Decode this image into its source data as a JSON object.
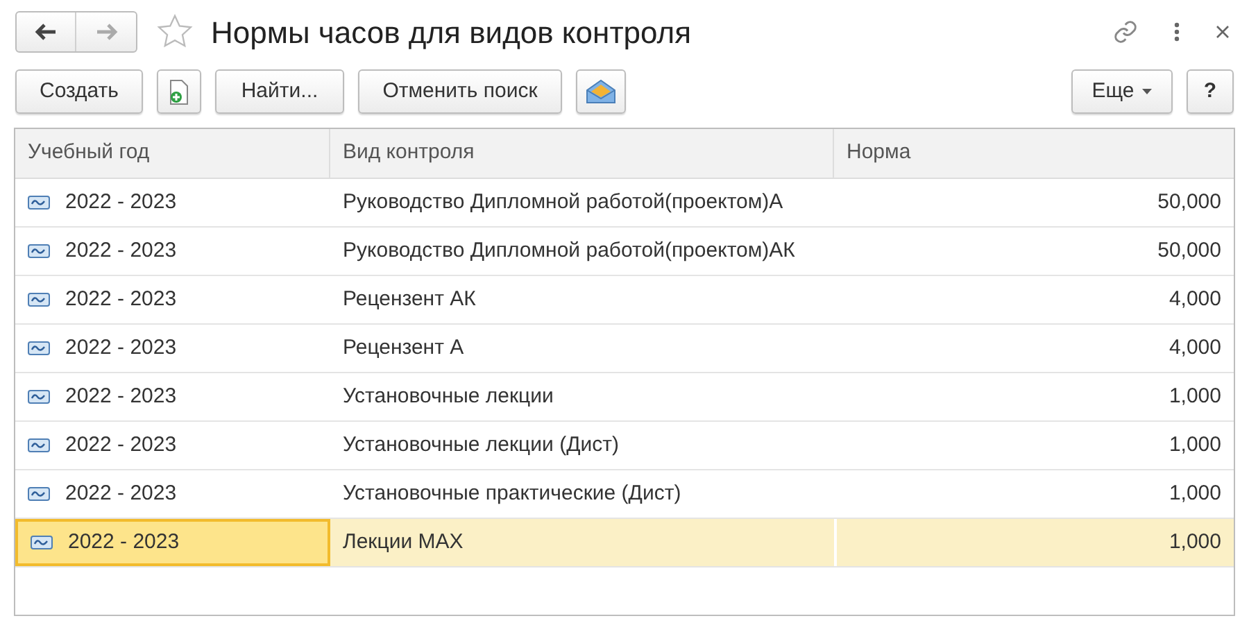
{
  "window": {
    "title": "Нормы часов для видов контроля",
    "favorite": false
  },
  "toolbar": {
    "create": "Создать",
    "find": "Найти...",
    "cancel_search": "Отменить поиск",
    "more": "Еще",
    "help": "?"
  },
  "table": {
    "columns": [
      "Учебный год",
      "Вид контроля",
      "Норма"
    ],
    "rows": [
      {
        "year": "2022 - 2023",
        "kind": "Руководство Дипломной работой(проектом)А",
        "norm": "50,000",
        "selected": false
      },
      {
        "year": "2022 - 2023",
        "kind": "Руководство Дипломной работой(проектом)АК",
        "norm": "50,000",
        "selected": false
      },
      {
        "year": "2022 - 2023",
        "kind": "Рецензент АК",
        "norm": "4,000",
        "selected": false
      },
      {
        "year": "2022 - 2023",
        "kind": "Рецензент А",
        "norm": "4,000",
        "selected": false
      },
      {
        "year": "2022 - 2023",
        "kind": "Установочные лекции",
        "norm": "1,000",
        "selected": false
      },
      {
        "year": "2022 - 2023",
        "kind": "Установочные лекции (Дист)",
        "norm": "1,000",
        "selected": false
      },
      {
        "year": "2022 - 2023",
        "kind": "Установочные практические (Дист)",
        "norm": "1,000",
        "selected": false
      },
      {
        "year": "2022 - 2023",
        "kind": "Лекции MAX",
        "norm": "1,000",
        "selected": true
      }
    ]
  }
}
